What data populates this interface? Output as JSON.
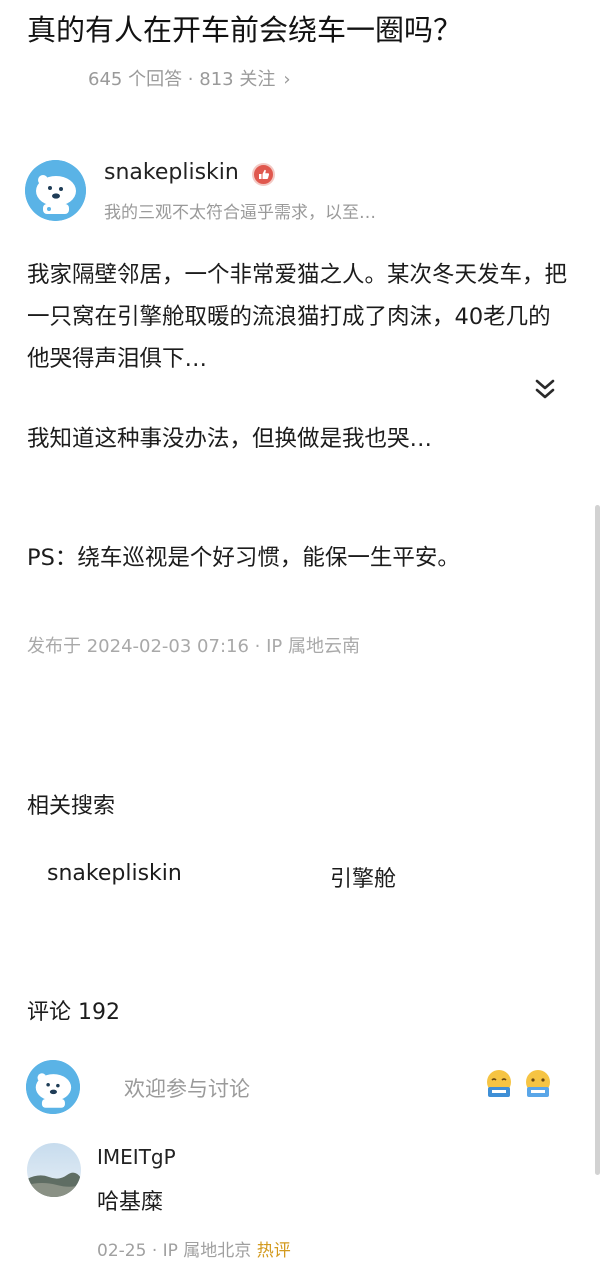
{
  "question": {
    "title": "真的有人在开车前会绕车一圈吗？",
    "meta": "645 个回答 · 813 关注",
    "meta_chevron": "›"
  },
  "answer": {
    "author": {
      "name": "snakepliskin",
      "bio": "我的三观不太符合逼乎需求，以至…",
      "badge_icon": "thumb-up-badge"
    },
    "paragraph1": "我家隔壁邻居，一个非常爱猫之人。某次冬天发车，把一只窝在引擎舱取暖的流浪猫打成了肉沫，40老几的他哭得声泪俱下…",
    "paragraph2": "我知道这种事没办法，但换做是我也哭…",
    "paragraph3": "PS：绕车巡视是个好习惯，能保一生平安。",
    "publish_info": "发布于 2024-02-03 07:16 · IP 属地云南",
    "expand_icon": "double-chevron-down-icon"
  },
  "related": {
    "title": "相关搜索",
    "items": [
      "snakepliskin",
      "引擎舱"
    ]
  },
  "comments": {
    "title": "评论 192",
    "input_placeholder": "欢迎参与讨论",
    "emoji_icons": [
      "thanks-emoji-icon",
      "praise-emoji-icon"
    ],
    "list": [
      {
        "user": "IMEITgP",
        "text": "哈基糜",
        "date": "02-25",
        "ip": "IP 属地北京",
        "tag": "热评"
      }
    ]
  },
  "colors": {
    "hot_tag": "#d39a1e",
    "avatar_blue": "#5ab3e6",
    "badge_red": "#e0584e"
  }
}
